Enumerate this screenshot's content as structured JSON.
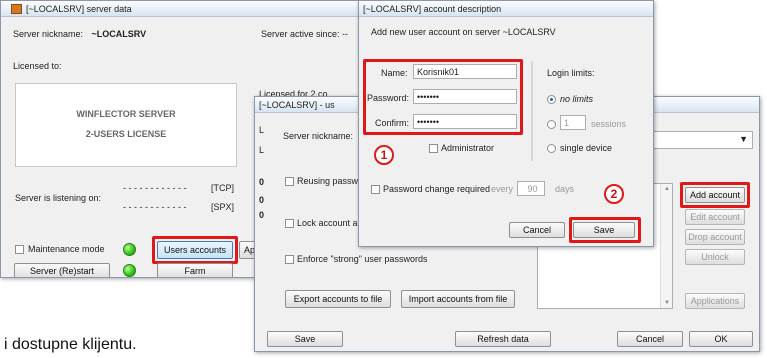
{
  "caption": "i dostupne klijentu.",
  "server_window": {
    "title": "[~LOCALSRV]  server data",
    "nickname_label": "Server nickname:",
    "nickname_value": "~LOCALSRV",
    "active_since_label": "Server active since:  --",
    "licensed_to_label": "Licensed to:",
    "license_line1": "WINFLECTOR SERVER",
    "license_line2": "2-USERS LICENSE",
    "licensed_for": "Licensed for   2   co",
    "listening_label": "Server is listening on:",
    "tcp_dashes": "- - - - - - - - - - - -",
    "tcp_label": "[TCP]",
    "spx_dashes": "- - - - - - - - - - - -",
    "spx_label": "[SPX]",
    "maintenance_label": "Maintenance mode",
    "users_button": "Users accounts",
    "appl_button": "Applic",
    "restart_button": "Server (Re)start",
    "farm_button": "Farm"
  },
  "users_window": {
    "title": "[~LOCALSRV] - us",
    "nickname_label": "Server nickname:",
    "reusing_label": "Reusing passwo",
    "lock_label": "Lock account a",
    "strong_label": "Enforce \"strong\" user passwords",
    "export_button": "Export accounts to file",
    "import_button": "Import accounts from file",
    "add_button": "Add account",
    "edit_button": "Edit account",
    "drop_button": "Drop account",
    "unlock_button": "Unlock",
    "applications_button": "Applications",
    "save_button": "Save",
    "refresh_button": "Refresh data",
    "cancel_button": "Cancel",
    "ok_button": "OK",
    "side_l1": "L",
    "side_l2": "L",
    "side_0a": "0",
    "side_0b": "0",
    "side_0c": "0"
  },
  "account_dialog": {
    "title": "[~LOCALSRV]  account description",
    "subtitle": "Add new user account on server ~LOCALSRV",
    "name_label": "Name:",
    "name_value": "Korisnik01",
    "password_label": "Password:",
    "password_value": "•••••••",
    "confirm_label": "Confirm:",
    "confirm_value": "•••••••",
    "administrator_label": "Administrator",
    "login_limits_label": "Login limits:",
    "no_limits_label": "no limits",
    "sessions_value": "1",
    "sessions_label": "sessions",
    "single_device_label": "single device",
    "pwd_change_label": "Password change required",
    "every_label": "every",
    "days_value": "90",
    "days_label": "days",
    "cancel_button": "Cancel",
    "save_button": "Save"
  },
  "annotations": {
    "step1": "1",
    "step2": "2"
  },
  "colors": {
    "highlight": "#e01818",
    "led": "#2fbf1a",
    "selected_button": "#3c7fb1"
  }
}
